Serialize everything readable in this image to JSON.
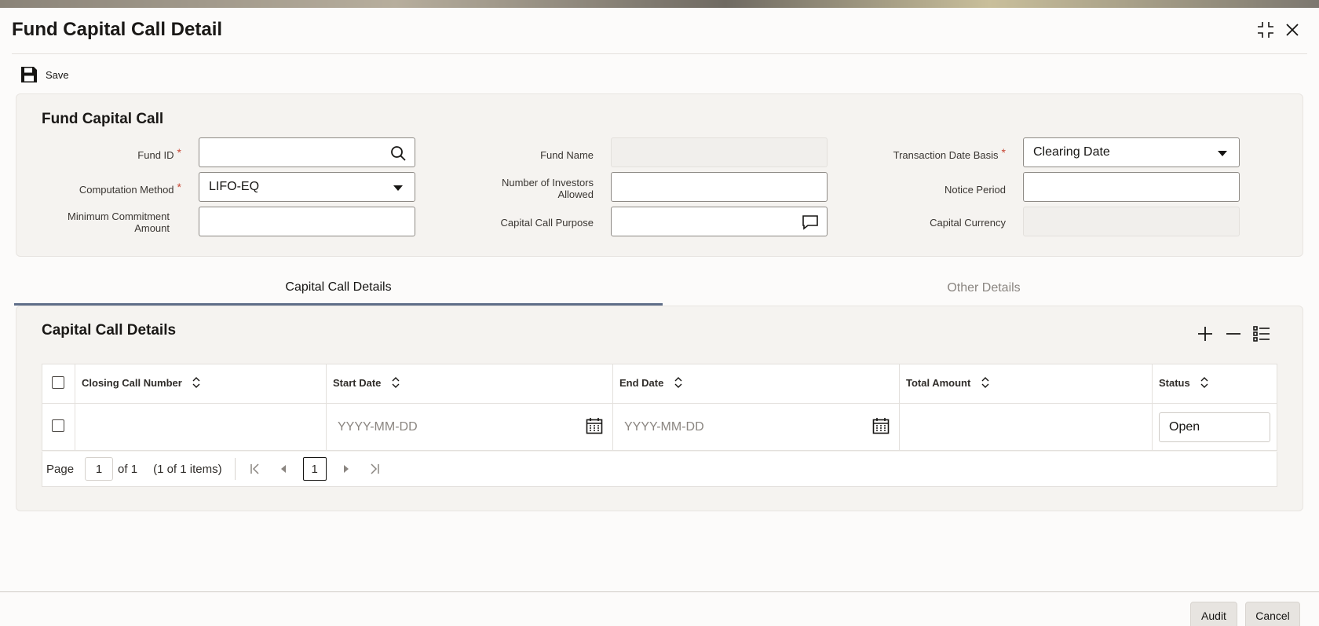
{
  "window": {
    "title": "Fund Capital Call Detail"
  },
  "toolbar": {
    "save_label": "Save"
  },
  "header_section": {
    "title": "Fund Capital Call",
    "fields": {
      "fund_id": {
        "label": "Fund ID",
        "value": ""
      },
      "computation_method": {
        "label": "Computation Method",
        "value": "LIFO-EQ"
      },
      "minimum_commitment": {
        "label_line1": "Minimum Commitment",
        "label_line2": "Amount",
        "value": ""
      },
      "fund_name": {
        "label": "Fund Name",
        "value": ""
      },
      "number_of_investors": {
        "label_line1": "Number of Investors",
        "label_line2": "Allowed",
        "value": ""
      },
      "capital_call_purpose": {
        "label": "Capital Call Purpose",
        "value": ""
      },
      "transaction_date_basis": {
        "label": "Transaction Date Basis",
        "value": "Clearing Date"
      },
      "notice_period": {
        "label": "Notice Period",
        "value": ""
      },
      "capital_currency": {
        "label": "Capital Currency",
        "value": ""
      }
    },
    "required_mark": "*"
  },
  "tabs": [
    {
      "label": "Capital Call Details",
      "active": true
    },
    {
      "label": "Other Details",
      "active": false
    }
  ],
  "details_section": {
    "title": "Capital Call Details",
    "columns": [
      "Closing Call Number",
      "Start Date",
      "End Date",
      "Total Amount",
      "Status"
    ],
    "rows": [
      {
        "closing_call_number": "",
        "start_date": "YYYY-MM-DD",
        "end_date": "YYYY-MM-DD",
        "total_amount": "",
        "status": "Open"
      }
    ]
  },
  "pager": {
    "page_label": "Page",
    "page_value": "1",
    "of_label": "of 1",
    "items_label": "(1 of 1 items)",
    "current_page": "1"
  },
  "footer": {
    "audit_label": "Audit",
    "cancel_label": "Cancel"
  },
  "colors": {
    "accent_tab": "#5f6e88",
    "required": "#c74634"
  }
}
